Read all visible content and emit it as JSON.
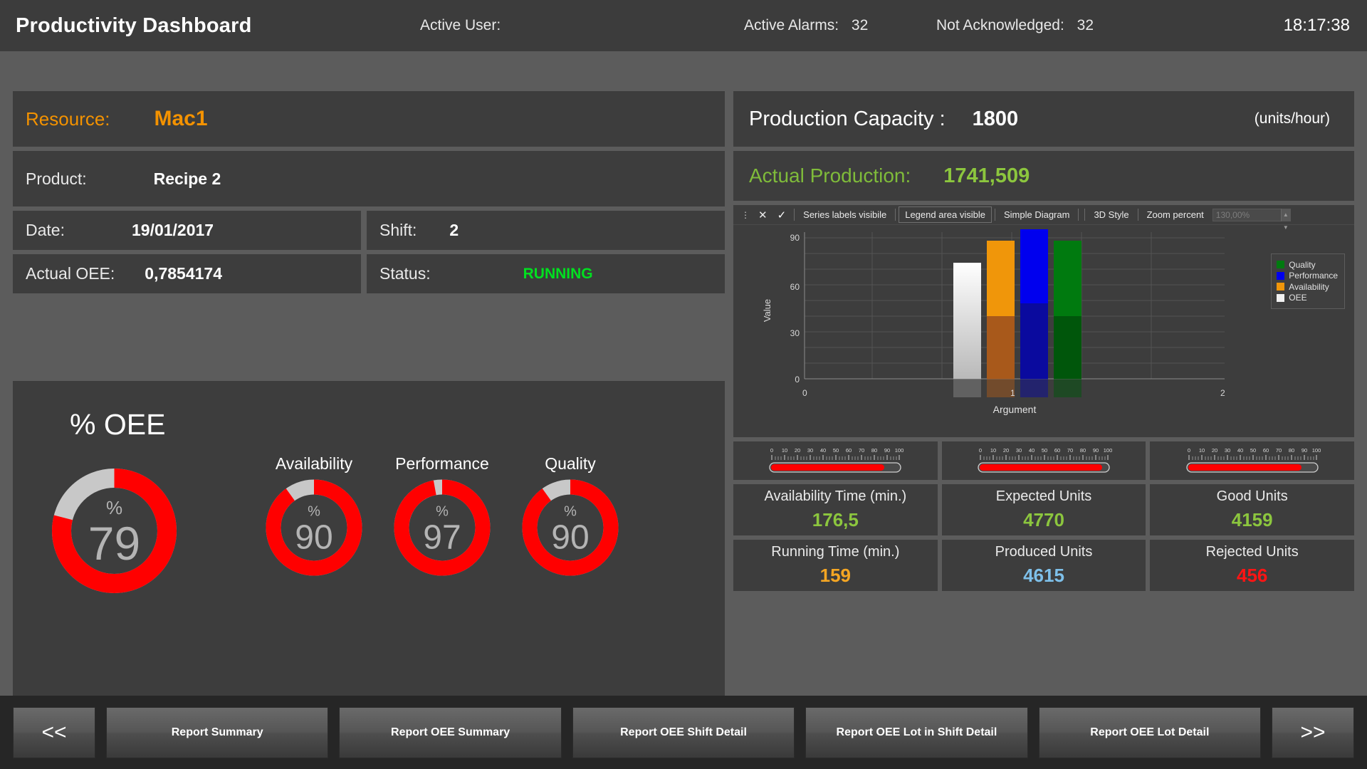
{
  "topbar": {
    "title": "Productivity Dashboard",
    "active_user_label": "Active User:",
    "active_user_value": "",
    "active_alarms_label": "Active Alarms:",
    "active_alarms_value": "32",
    "not_acknowledged_label": "Not Acknowledged:",
    "not_acknowledged_value": "32",
    "clock": "18:17:38"
  },
  "info_left": {
    "resource_label": "Resource:",
    "resource_value": "Mac1",
    "product_label": "Product:",
    "product_value": "Recipe 2",
    "date_label": "Date:",
    "date_value": "19/01/2017",
    "shift_label": "Shift:",
    "shift_value": "2",
    "actual_oee_label": "Actual OEE:",
    "actual_oee_value": "0,7854174",
    "status_label": "Status:",
    "status_value": "RUNNING"
  },
  "info_right": {
    "capacity_label": "Production Capacity :",
    "capacity_value": "1800",
    "capacity_units": "(units/hour)",
    "actual_production_label": "Actual Production:",
    "actual_production_value": "1741,509"
  },
  "oee_section": {
    "title": "% OEE",
    "percent_symbol": "%",
    "gauges": [
      {
        "label": "",
        "value": "79",
        "percent": 79
      },
      {
        "label": "Availability",
        "value": "90",
        "percent": 90
      },
      {
        "label": "Performance",
        "value": "97",
        "percent": 97
      },
      {
        "label": "Quality",
        "value": "90",
        "percent": 90
      }
    ]
  },
  "chart_toolbar": {
    "drag_handle": "⋮",
    "close_label": "✕",
    "check_label": "✓",
    "series_labels": "Series labels visibile",
    "legend_area": "Legend area visible",
    "simple_diagram": "Simple Diagram",
    "style_3d": "3D Style",
    "zoom_percent_label": "Zoom percent",
    "zoom_percent_value": "130,00%"
  },
  "chart_data": {
    "type": "bar",
    "title": "",
    "xlabel": "Argument",
    "ylabel": "Value",
    "xticks": [
      "0",
      "1",
      "2"
    ],
    "yticks": [
      "0",
      "30",
      "60",
      "90"
    ],
    "ylim": [
      0,
      100
    ],
    "grid": true,
    "legend_position": "right",
    "categories": [
      "1"
    ],
    "series": [
      {
        "name": "OEE",
        "color": "#f2f2f2",
        "values": [
          79
        ]
      },
      {
        "name": "Availability",
        "color": "#f0960a",
        "values": [
          90
        ]
      },
      {
        "name": "Performance",
        "color": "#0000ee",
        "values": [
          97
        ]
      },
      {
        "name": "Quality",
        "color": "#007a0f",
        "values": [
          90
        ]
      }
    ],
    "legend_entries": [
      {
        "label": "Quality",
        "color": "#007a0f"
      },
      {
        "label": "Performance",
        "color": "#0000ee"
      },
      {
        "label": "Availability",
        "color": "#f0960a"
      },
      {
        "label": "OEE",
        "color": "#f2f2f2"
      }
    ]
  },
  "linear_gauges": {
    "scale_ticks": [
      "0",
      "10",
      "20",
      "30",
      "40",
      "50",
      "60",
      "70",
      "80",
      "90",
      "100"
    ],
    "bars": [
      {
        "name": "availability",
        "percent": 90
      },
      {
        "name": "performance",
        "percent": 97
      },
      {
        "name": "quality",
        "percent": 90
      }
    ]
  },
  "metrics": [
    {
      "label": "Availability Time (min.)",
      "value": "176,5",
      "color": "#8cc63e"
    },
    {
      "label": "Expected Units",
      "value": "4770",
      "color": "#8cc63e"
    },
    {
      "label": "Good Units",
      "value": "4159",
      "color": "#8cc63e"
    },
    {
      "label": "Running Time (min.)",
      "value": "159",
      "color": "#f5a623"
    },
    {
      "label": "Produced Units",
      "value": "4615",
      "color": "#7ec0ea"
    },
    {
      "label": "Rejected Units",
      "value": "456",
      "color": "#ff1414"
    }
  ],
  "buttons": {
    "prev": "<<",
    "next": ">>",
    "reports": [
      "Report Summary",
      "Report OEE Summary",
      "Report OEE Shift Detail",
      "Report OEE Lot in Shift Detail",
      "Report OEE Lot Detail"
    ]
  },
  "colors": {
    "gauge_active": "#ff0000",
    "gauge_track": "#c8c8c8",
    "accent_orange": "#f39200",
    "status_green": "#00e020",
    "panel": "#3d3d3d",
    "background": "#5c5c5c"
  }
}
